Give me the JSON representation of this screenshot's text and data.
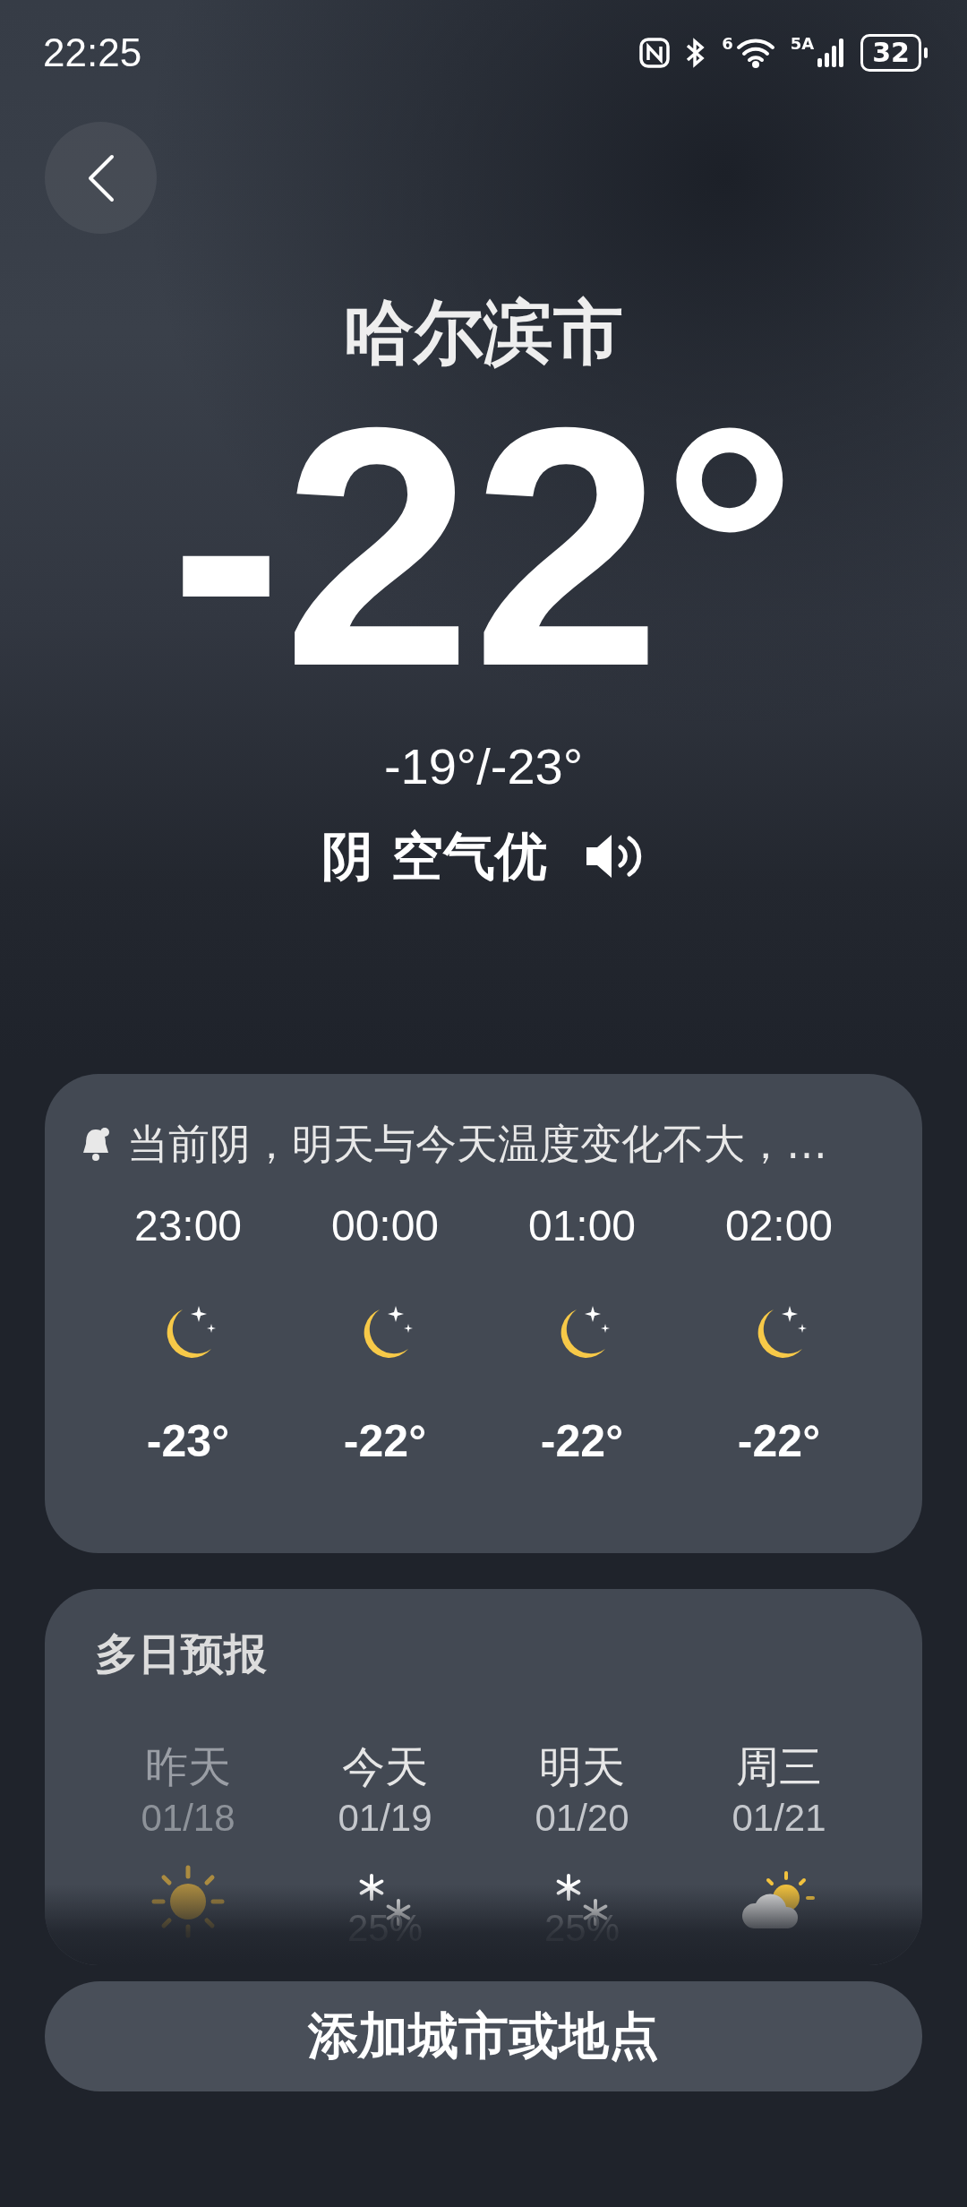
{
  "status_bar": {
    "time": "22:25",
    "wifi_label": "6",
    "signal_label": "5A",
    "battery": "32"
  },
  "city": "哈尔滨市",
  "temperature": "-22°",
  "high_low": "-19°/-23°",
  "condition": "阴 空气优",
  "hourly": {
    "alert": "当前阴，明天与今天温度变化不大，…",
    "hours": [
      {
        "time": "23:00",
        "kind": "moon",
        "temp": "-23°"
      },
      {
        "time": "00:00",
        "kind": "moon",
        "temp": "-22°"
      },
      {
        "time": "01:00",
        "kind": "moon",
        "temp": "-22°"
      },
      {
        "time": "02:00",
        "kind": "moon",
        "temp": "-22°"
      }
    ]
  },
  "daily": {
    "title": "多日预报",
    "days": [
      {
        "day": "昨天",
        "date": "01/18",
        "kind": "sun",
        "past": true
      },
      {
        "day": "今天",
        "date": "01/19",
        "kind": "snow",
        "chance": "25%",
        "past": false
      },
      {
        "day": "明天",
        "date": "01/20",
        "kind": "snow",
        "chance": "25%",
        "past": false
      },
      {
        "day": "周三",
        "date": "01/21",
        "kind": "partly-cloudy",
        "past": false
      }
    ]
  },
  "add_button": "添加城市或地点"
}
